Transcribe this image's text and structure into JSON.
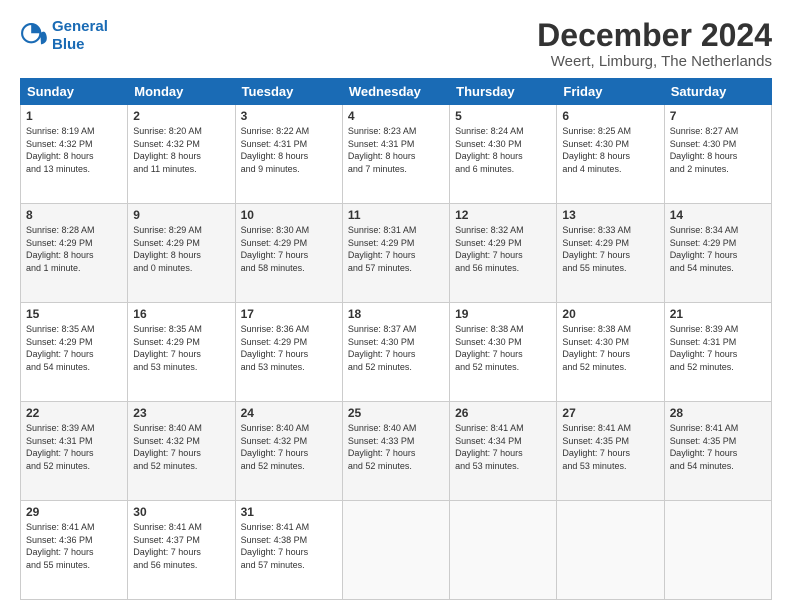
{
  "logo": {
    "line1": "General",
    "line2": "Blue"
  },
  "title": "December 2024",
  "subtitle": "Weert, Limburg, The Netherlands",
  "days_of_week": [
    "Sunday",
    "Monday",
    "Tuesday",
    "Wednesday",
    "Thursday",
    "Friday",
    "Saturday"
  ],
  "weeks": [
    [
      {
        "day": "1",
        "info": "Sunrise: 8:19 AM\nSunset: 4:32 PM\nDaylight: 8 hours\nand 13 minutes."
      },
      {
        "day": "2",
        "info": "Sunrise: 8:20 AM\nSunset: 4:32 PM\nDaylight: 8 hours\nand 11 minutes."
      },
      {
        "day": "3",
        "info": "Sunrise: 8:22 AM\nSunset: 4:31 PM\nDaylight: 8 hours\nand 9 minutes."
      },
      {
        "day": "4",
        "info": "Sunrise: 8:23 AM\nSunset: 4:31 PM\nDaylight: 8 hours\nand 7 minutes."
      },
      {
        "day": "5",
        "info": "Sunrise: 8:24 AM\nSunset: 4:30 PM\nDaylight: 8 hours\nand 6 minutes."
      },
      {
        "day": "6",
        "info": "Sunrise: 8:25 AM\nSunset: 4:30 PM\nDaylight: 8 hours\nand 4 minutes."
      },
      {
        "day": "7",
        "info": "Sunrise: 8:27 AM\nSunset: 4:30 PM\nDaylight: 8 hours\nand 2 minutes."
      }
    ],
    [
      {
        "day": "8",
        "info": "Sunrise: 8:28 AM\nSunset: 4:29 PM\nDaylight: 8 hours\nand 1 minute."
      },
      {
        "day": "9",
        "info": "Sunrise: 8:29 AM\nSunset: 4:29 PM\nDaylight: 8 hours\nand 0 minutes."
      },
      {
        "day": "10",
        "info": "Sunrise: 8:30 AM\nSunset: 4:29 PM\nDaylight: 7 hours\nand 58 minutes."
      },
      {
        "day": "11",
        "info": "Sunrise: 8:31 AM\nSunset: 4:29 PM\nDaylight: 7 hours\nand 57 minutes."
      },
      {
        "day": "12",
        "info": "Sunrise: 8:32 AM\nSunset: 4:29 PM\nDaylight: 7 hours\nand 56 minutes."
      },
      {
        "day": "13",
        "info": "Sunrise: 8:33 AM\nSunset: 4:29 PM\nDaylight: 7 hours\nand 55 minutes."
      },
      {
        "day": "14",
        "info": "Sunrise: 8:34 AM\nSunset: 4:29 PM\nDaylight: 7 hours\nand 54 minutes."
      }
    ],
    [
      {
        "day": "15",
        "info": "Sunrise: 8:35 AM\nSunset: 4:29 PM\nDaylight: 7 hours\nand 54 minutes."
      },
      {
        "day": "16",
        "info": "Sunrise: 8:35 AM\nSunset: 4:29 PM\nDaylight: 7 hours\nand 53 minutes."
      },
      {
        "day": "17",
        "info": "Sunrise: 8:36 AM\nSunset: 4:29 PM\nDaylight: 7 hours\nand 53 minutes."
      },
      {
        "day": "18",
        "info": "Sunrise: 8:37 AM\nSunset: 4:30 PM\nDaylight: 7 hours\nand 52 minutes."
      },
      {
        "day": "19",
        "info": "Sunrise: 8:38 AM\nSunset: 4:30 PM\nDaylight: 7 hours\nand 52 minutes."
      },
      {
        "day": "20",
        "info": "Sunrise: 8:38 AM\nSunset: 4:30 PM\nDaylight: 7 hours\nand 52 minutes."
      },
      {
        "day": "21",
        "info": "Sunrise: 8:39 AM\nSunset: 4:31 PM\nDaylight: 7 hours\nand 52 minutes."
      }
    ],
    [
      {
        "day": "22",
        "info": "Sunrise: 8:39 AM\nSunset: 4:31 PM\nDaylight: 7 hours\nand 52 minutes."
      },
      {
        "day": "23",
        "info": "Sunrise: 8:40 AM\nSunset: 4:32 PM\nDaylight: 7 hours\nand 52 minutes."
      },
      {
        "day": "24",
        "info": "Sunrise: 8:40 AM\nSunset: 4:32 PM\nDaylight: 7 hours\nand 52 minutes."
      },
      {
        "day": "25",
        "info": "Sunrise: 8:40 AM\nSunset: 4:33 PM\nDaylight: 7 hours\nand 52 minutes."
      },
      {
        "day": "26",
        "info": "Sunrise: 8:41 AM\nSunset: 4:34 PM\nDaylight: 7 hours\nand 53 minutes."
      },
      {
        "day": "27",
        "info": "Sunrise: 8:41 AM\nSunset: 4:35 PM\nDaylight: 7 hours\nand 53 minutes."
      },
      {
        "day": "28",
        "info": "Sunrise: 8:41 AM\nSunset: 4:35 PM\nDaylight: 7 hours\nand 54 minutes."
      }
    ],
    [
      {
        "day": "29",
        "info": "Sunrise: 8:41 AM\nSunset: 4:36 PM\nDaylight: 7 hours\nand 55 minutes."
      },
      {
        "day": "30",
        "info": "Sunrise: 8:41 AM\nSunset: 4:37 PM\nDaylight: 7 hours\nand 56 minutes."
      },
      {
        "day": "31",
        "info": "Sunrise: 8:41 AM\nSunset: 4:38 PM\nDaylight: 7 hours\nand 57 minutes."
      },
      {
        "day": "",
        "info": ""
      },
      {
        "day": "",
        "info": ""
      },
      {
        "day": "",
        "info": ""
      },
      {
        "day": "",
        "info": ""
      }
    ]
  ]
}
